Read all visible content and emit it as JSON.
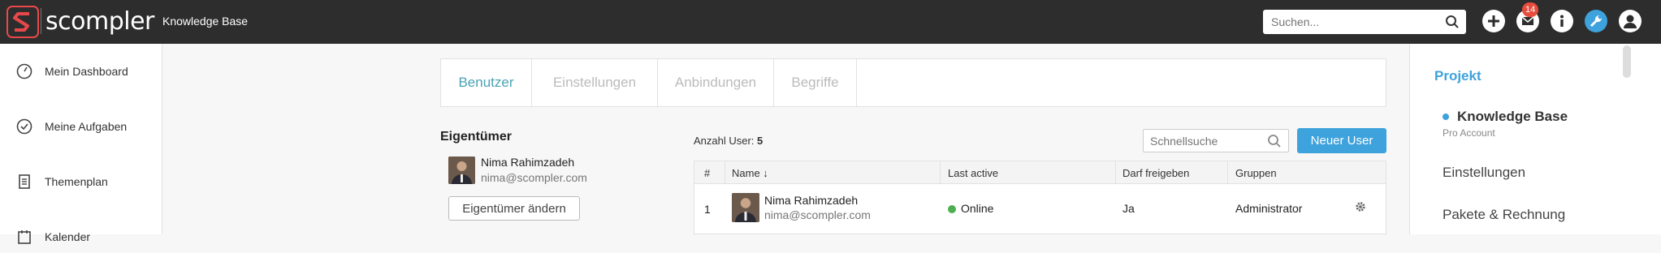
{
  "topbar": {
    "brand": "scompler",
    "title": "Knowledge Base",
    "search_placeholder": "Suchen...",
    "notifications_count": "14",
    "icons": [
      "plus-icon",
      "mail-icon",
      "info-icon",
      "wrench-icon",
      "user-icon"
    ],
    "brand_color": "#e8484a"
  },
  "sidebar": {
    "items": [
      {
        "label": "Mein Dashboard",
        "icon": "gauge-icon"
      },
      {
        "label": "Meine Aufgaben",
        "icon": "check-circle-icon"
      },
      {
        "label": "Themenplan",
        "icon": "document-icon"
      },
      {
        "label": "Kalender",
        "icon": "calendar-icon"
      }
    ]
  },
  "tabs": [
    {
      "label": "Benutzer",
      "active": true
    },
    {
      "label": "Einstellungen",
      "active": false
    },
    {
      "label": "Anbindungen",
      "active": false
    },
    {
      "label": "Begriffe",
      "active": false
    }
  ],
  "owner": {
    "title": "Eigentümer",
    "name": "Nima Rahimzadeh",
    "email": "nima@scompler.com",
    "change_button": "Eigentümer ändern"
  },
  "users": {
    "count_label": "Anzahl User:",
    "count_value": "5",
    "quicksearch_placeholder": "Schnellsuche",
    "new_user_button": "Neuer User",
    "columns": [
      "#",
      "Name ↓",
      "Last active",
      "Darf freigeben",
      "Gruppen"
    ],
    "rows": [
      {
        "index": "1",
        "name": "Nima Rahimzadeh",
        "email": "nima@scompler.com",
        "last_active": "Online",
        "can_release": "Ja",
        "groups": "Administrator"
      }
    ]
  },
  "right_panel": {
    "section": "Projekt",
    "project_name": "Knowledge Base",
    "account": "Pro Account",
    "links": [
      "Einstellungen",
      "Pakete & Rechnung"
    ],
    "accent_color": "#3ea2dc"
  }
}
